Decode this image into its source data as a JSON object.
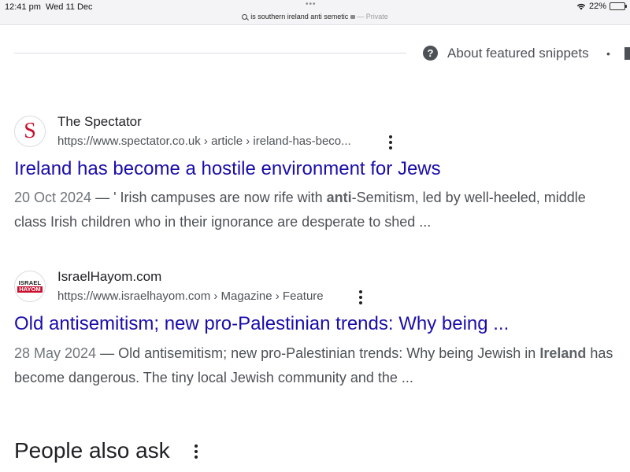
{
  "status_bar": {
    "time": "12:41 pm",
    "date": "Wed 11 Dec",
    "dots": "•••",
    "address_text": "is southern ireland anti semetic",
    "private_label": "— Private",
    "battery_percent": "22%",
    "battery_level": 0.22
  },
  "snippets_header": {
    "help_glyph": "?",
    "label": "About featured snippets",
    "separator": "•"
  },
  "results": [
    {
      "site_name": "The Spectator",
      "url": "https://www.spectator.co.uk › article › ireland-has-beco...",
      "favicon_text": "S",
      "title": "Ireland has become a hostile environment for Jews",
      "date": "20 Oct 2024",
      "dash": " — ",
      "snippet_pre": "' Irish campuses are now rife with ",
      "snippet_bold": "anti",
      "snippet_post": "-Semitism, led by well-heeled, middle class Irish children who in their ignorance are desperate to shed ..."
    },
    {
      "site_name": "IsraelHayom.com",
      "url": "https://www.israelhayom.com › Magazine › Feature",
      "favicon_line1": "ISRAEL",
      "favicon_line2": "HAYOM",
      "title": "Old antisemitism; new pro-Palestinian trends: Why being ...",
      "date": "28 May 2024",
      "dash": " — ",
      "snippet_pre": "Old antisemitism; new pro-Palestinian trends: Why being Jewish in ",
      "snippet_bold": "Ireland",
      "snippet_post": " has become dangerous. The tiny local Jewish community and the ..."
    }
  ],
  "people_also_ask": {
    "title": "People also ask"
  },
  "colors": {
    "link": "#1a0dab",
    "snippet_text": "#4d5156",
    "battery_green": "#34c759",
    "spectator_red": "#c8102e"
  }
}
